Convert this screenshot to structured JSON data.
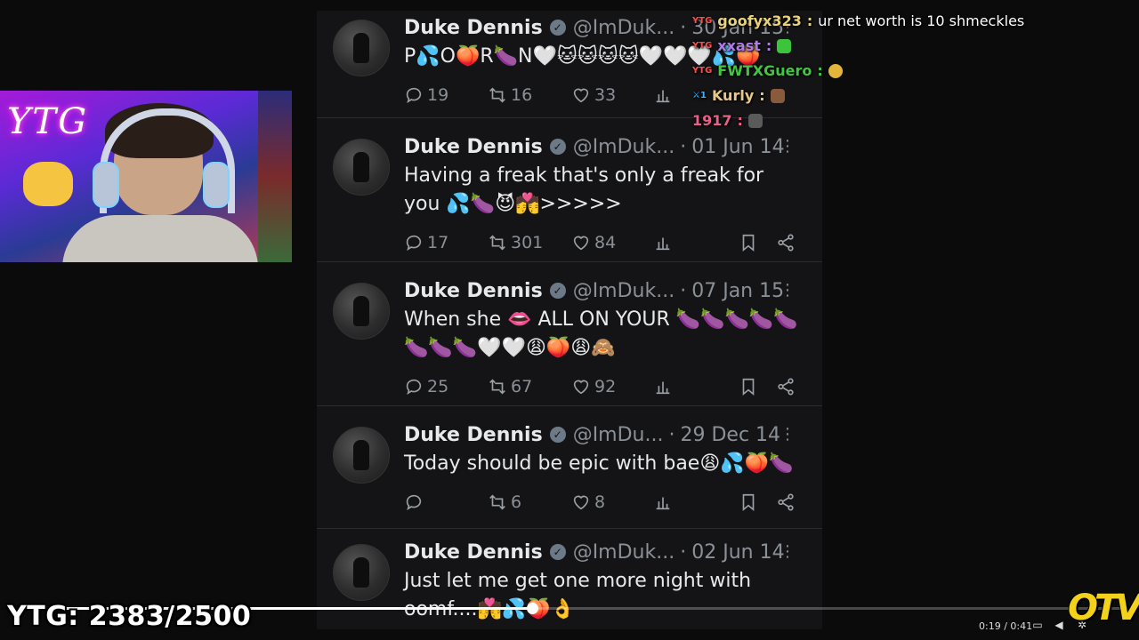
{
  "tweets": [
    {
      "name": "Duke Dennis",
      "handle": "@ImDuk...",
      "date": "30 Jan 15",
      "text": "P💦O🍑R🍆N🤍🐱🐱🐱🐱🤍🤍🤍💦🍑",
      "replies": "19",
      "retweets": "16",
      "likes": "33",
      "views": ""
    },
    {
      "name": "Duke Dennis",
      "handle": "@ImDuk...",
      "date": "01 Jun 14",
      "text": "Having a freak that's only a freak for you 💦🍆😈💏>>>>>",
      "replies": "17",
      "retweets": "301",
      "likes": "84",
      "views": ""
    },
    {
      "name": "Duke Dennis",
      "handle": "@ImDuk...",
      "date": "07 Jan 15",
      "text": "When she 👄 ALL ON YOUR 🍆🍆🍆🍆🍆🍆🍆🍆🤍🤍😩🍑😩🙈",
      "replies": "25",
      "retweets": "67",
      "likes": "92",
      "views": ""
    },
    {
      "name": "Duke Dennis",
      "handle": "@ImDu...",
      "date": "29 Dec 14",
      "text": "Today should be epic with bae😩💦🍑🍆",
      "replies": "",
      "retweets": "6",
      "likes": "8",
      "views": ""
    },
    {
      "name": "Duke Dennis",
      "handle": "@ImDuk...",
      "date": "02 Jun 14",
      "text": "Just let me get one more night with oomf....💏💦🍑👌",
      "replies": "",
      "retweets": "",
      "likes": "",
      "views": ""
    }
  ],
  "tweet_separator": "·",
  "verified_glyph": "✓",
  "more_glyph": "⋮",
  "webcam": {
    "logo": "YTG"
  },
  "chat": [
    {
      "badge": "YTG",
      "user": "goofyx323",
      "user_color": "#e8d37a",
      "message": "ur net worth is 10 shmeckles",
      "emote": ""
    },
    {
      "badge": "YTG",
      "user": "xxast",
      "user_color": "#b07be6",
      "message": "",
      "emote": "#3cc43c"
    },
    {
      "badge": "YTG",
      "user": "FWTXGuero",
      "user_color": "#43c443",
      "message": "",
      "emote": "#e4b63a"
    },
    {
      "badge": "⚔1",
      "user": "Kurly",
      "user_color": "#e6c88a",
      "message": "",
      "emote": "#8a5a3c"
    },
    {
      "badge": "",
      "user": "1917",
      "user_color": "#e8608a",
      "message": "",
      "emote": "#5a5a5a"
    }
  ],
  "chat_colon": ":",
  "overlay": {
    "counter": "YTG: 2383/2500",
    "logo": "OTV"
  },
  "player": {
    "time": "0:19 / 0:41",
    "progress": 0.47
  }
}
